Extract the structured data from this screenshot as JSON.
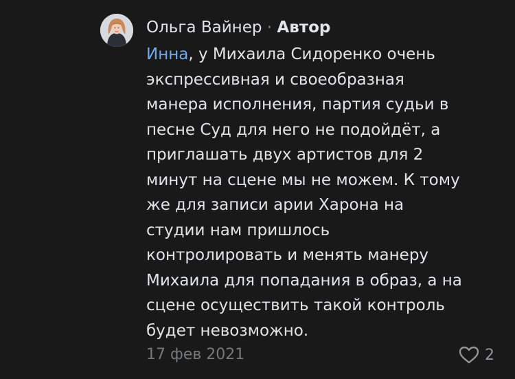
{
  "comment": {
    "author": {
      "name": "Ольга Вайнер",
      "separator": "·",
      "badge": "Автор"
    },
    "mention": "Инна",
    "text_lines": [
      ", у Михаила Сидоренко очень",
      "экспрессивная и своеобразная",
      "манера исполнения, партия судьи в",
      "песне Суд для него не подойдёт, а",
      "приглашать двух артистов для 2",
      "минут на сцене мы не можем. К тому",
      "же для записи арии Харона на",
      "студии нам пришлось",
      "контролировать и менять манеру",
      "Михаила для попадания в образ, а на",
      "сцене осуществить такой контроль",
      "будет невозможно."
    ],
    "date": "17 фев 2021",
    "likes": {
      "icon": "heart-icon",
      "count": "2"
    }
  },
  "colors": {
    "background": "#19191a",
    "text": "#e1e3e6",
    "mention": "#71aaeb",
    "secondary": "#76787a"
  }
}
